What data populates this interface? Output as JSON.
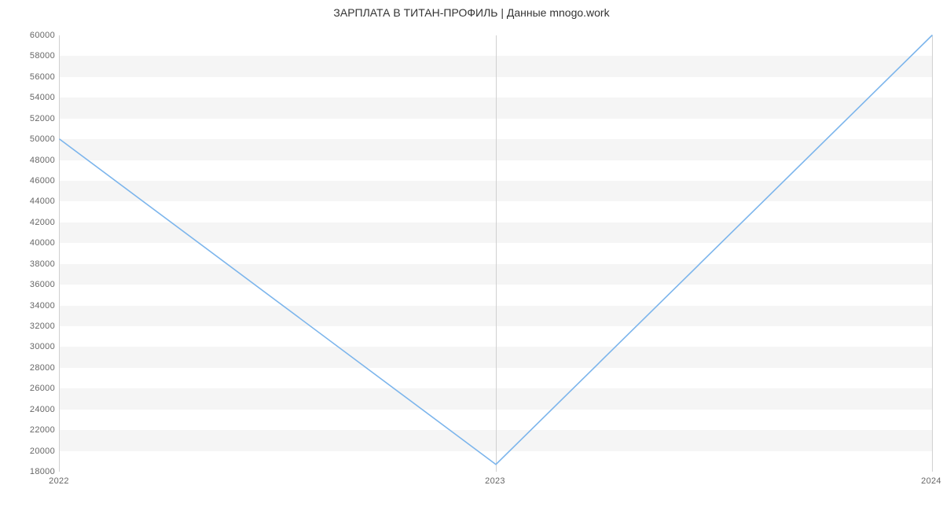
{
  "chart_data": {
    "type": "line",
    "title": "ЗАРПЛАТА В ТИТАН-ПРОФИЛЬ | Данные mnogo.work",
    "xlabel": "",
    "ylabel": "",
    "x": [
      "2022",
      "2023",
      "2024"
    ],
    "values": [
      50000,
      18700,
      60000
    ],
    "y_ticks": [
      18000,
      20000,
      22000,
      24000,
      26000,
      28000,
      30000,
      32000,
      34000,
      36000,
      38000,
      40000,
      42000,
      44000,
      46000,
      48000,
      50000,
      52000,
      54000,
      56000,
      58000,
      60000
    ],
    "x_ticks": [
      "2022",
      "2023",
      "2024"
    ],
    "ylim": [
      18000,
      60000
    ],
    "line_color": "#7cb5ec"
  }
}
